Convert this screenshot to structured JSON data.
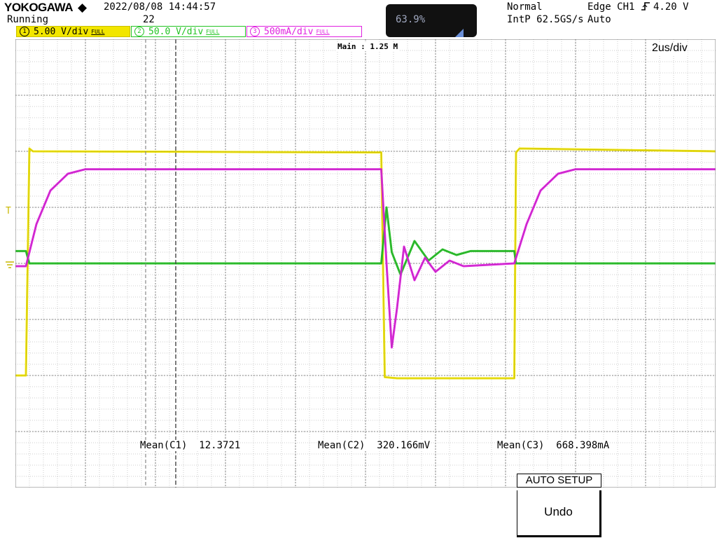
{
  "header": {
    "brand": "YOKOGAWA",
    "brand_mark": "◆",
    "run_state": "Running",
    "datetime": "2022/08/08 14:44:57",
    "acq_count": "22",
    "zoom_value": "63.9%",
    "trigger_mode": "Normal",
    "sample_rate": "IntP 62.5GS/s",
    "trigger_source": "Edge CH1",
    "trigger_slope_icon": "rising-edge-icon",
    "trigger_level": "4.20 V",
    "trigger_auto": "Auto"
  },
  "channels": [
    {
      "number": "1",
      "scale": "5.00 V/div",
      "bw_label": "FULL",
      "color": "#f2e600"
    },
    {
      "number": "2",
      "scale": "50.0 V/div",
      "bw_label": "FULL",
      "color": "#22c422"
    },
    {
      "number": "3",
      "scale": "500mA/div",
      "bw_label": "FULL",
      "color": "#e020e0"
    }
  ],
  "display": {
    "main_label": "Main : 1.25 M",
    "timebase": "2us/div",
    "trigger_marker": "T",
    "grid_divisions": {
      "x": 10,
      "y": 8
    },
    "colors": {
      "grid": "#9a9a9a",
      "background": "#ffffff"
    }
  },
  "measurements": [
    {
      "label": "Mean(C1)",
      "value": "12.3721"
    },
    {
      "label": "Mean(C2)",
      "value": "320.166mV"
    },
    {
      "label": "Mean(C3)",
      "value": "668.398mA"
    }
  ],
  "menu": {
    "title": "AUTO SETUP",
    "undo_label": "Undo"
  },
  "chart_data": {
    "type": "line",
    "x_unit": "us",
    "xlim": [
      -10,
      10
    ],
    "ylim": [
      -4,
      4
    ],
    "series": [
      {
        "name": "CH1",
        "color": "#f2e600",
        "points": [
          [
            -10,
            -2.0
          ],
          [
            -9.7,
            -2.0
          ],
          [
            -9.6,
            2.05
          ],
          [
            -9.5,
            2.0
          ],
          [
            0.45,
            1.98
          ],
          [
            0.55,
            -2.03
          ],
          [
            0.9,
            -2.05
          ],
          [
            4.25,
            -2.05
          ],
          [
            4.3,
            1.98
          ],
          [
            4.4,
            2.05
          ],
          [
            10,
            2.0
          ]
        ]
      },
      {
        "name": "CH2",
        "color": "#22c422",
        "points": [
          [
            -10,
            0.22
          ],
          [
            -9.7,
            0.22
          ],
          [
            -9.6,
            0.0
          ],
          [
            0.45,
            0.0
          ],
          [
            0.6,
            1.0
          ],
          [
            0.75,
            0.2
          ],
          [
            1.0,
            -0.2
          ],
          [
            1.4,
            0.4
          ],
          [
            1.8,
            0.05
          ],
          [
            2.2,
            0.25
          ],
          [
            2.6,
            0.15
          ],
          [
            3.0,
            0.22
          ],
          [
            4.25,
            0.22
          ],
          [
            4.3,
            0.0
          ],
          [
            10,
            0.0
          ]
        ]
      },
      {
        "name": "CH3",
        "color": "#e020e0",
        "points": [
          [
            -10,
            -0.05
          ],
          [
            -9.7,
            -0.05
          ],
          [
            -9.4,
            0.7
          ],
          [
            -9.0,
            1.3
          ],
          [
            -8.5,
            1.6
          ],
          [
            -8.0,
            1.68
          ],
          [
            0.45,
            1.68
          ],
          [
            0.6,
            0.0
          ],
          [
            0.75,
            -1.5
          ],
          [
            0.9,
            -0.8
          ],
          [
            1.1,
            0.3
          ],
          [
            1.4,
            -0.3
          ],
          [
            1.7,
            0.1
          ],
          [
            2.0,
            -0.15
          ],
          [
            2.4,
            0.05
          ],
          [
            2.8,
            -0.05
          ],
          [
            4.25,
            0.0
          ],
          [
            4.6,
            0.7
          ],
          [
            5.0,
            1.3
          ],
          [
            5.5,
            1.6
          ],
          [
            6.0,
            1.68
          ],
          [
            10,
            1.68
          ]
        ]
      }
    ]
  }
}
